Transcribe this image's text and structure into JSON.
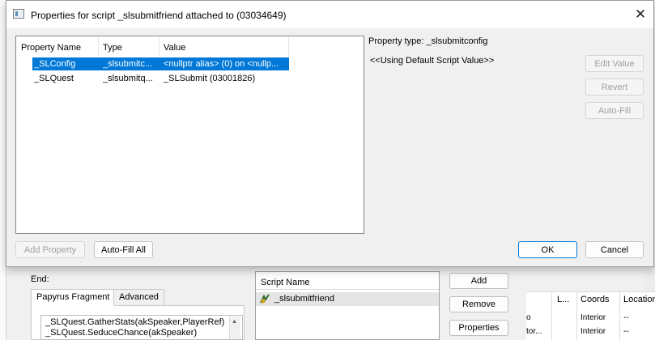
{
  "dialog": {
    "title": "Properties for script _slsubmitfriend attached to  (03034649)",
    "columns": [
      "Property Name",
      "Type",
      "Value"
    ],
    "properties": [
      {
        "name": "_SLConfig",
        "type": "_slsubmitc...",
        "value": "<nullptr alias> (0) on <nullp..."
      },
      {
        "name": "_SLQuest",
        "type": "_slsubmitq...",
        "value": "_SLSubmit (03001826)"
      }
    ],
    "property_type": "Property type: _slsubmitconfig",
    "property_value": "<<Using Default Script Value>>",
    "buttons": {
      "edit_value": "Edit Value",
      "revert": "Revert",
      "auto_fill": "Auto-Fill",
      "add_property": "Add Property",
      "auto_fill_all": "Auto-Fill All",
      "ok": "OK",
      "cancel": "Cancel"
    },
    "selection_color": "#0078d7"
  },
  "background": {
    "end_label": "End:",
    "tabs": [
      "Papyrus Fragment",
      "Advanced"
    ],
    "code_lines": [
      "_SLQuest.GatherStats(akSpeaker,PlayerRef)",
      "_SLQuest.SeduceChance(akSpeaker)"
    ],
    "script_list": {
      "header": "Script Name",
      "items": [
        "_slsubmitfriend"
      ]
    },
    "script_buttons": {
      "add": "Add",
      "remove": "Remove",
      "properties": "Properties"
    },
    "table": {
      "headers": [
        "L...",
        "Coords",
        "Location"
      ],
      "rows": [
        {
          "col0": "o",
          "coords": "Interior",
          "location": "--"
        },
        {
          "col0": "tor...",
          "coords": "Interior",
          "location": "--"
        }
      ]
    }
  }
}
